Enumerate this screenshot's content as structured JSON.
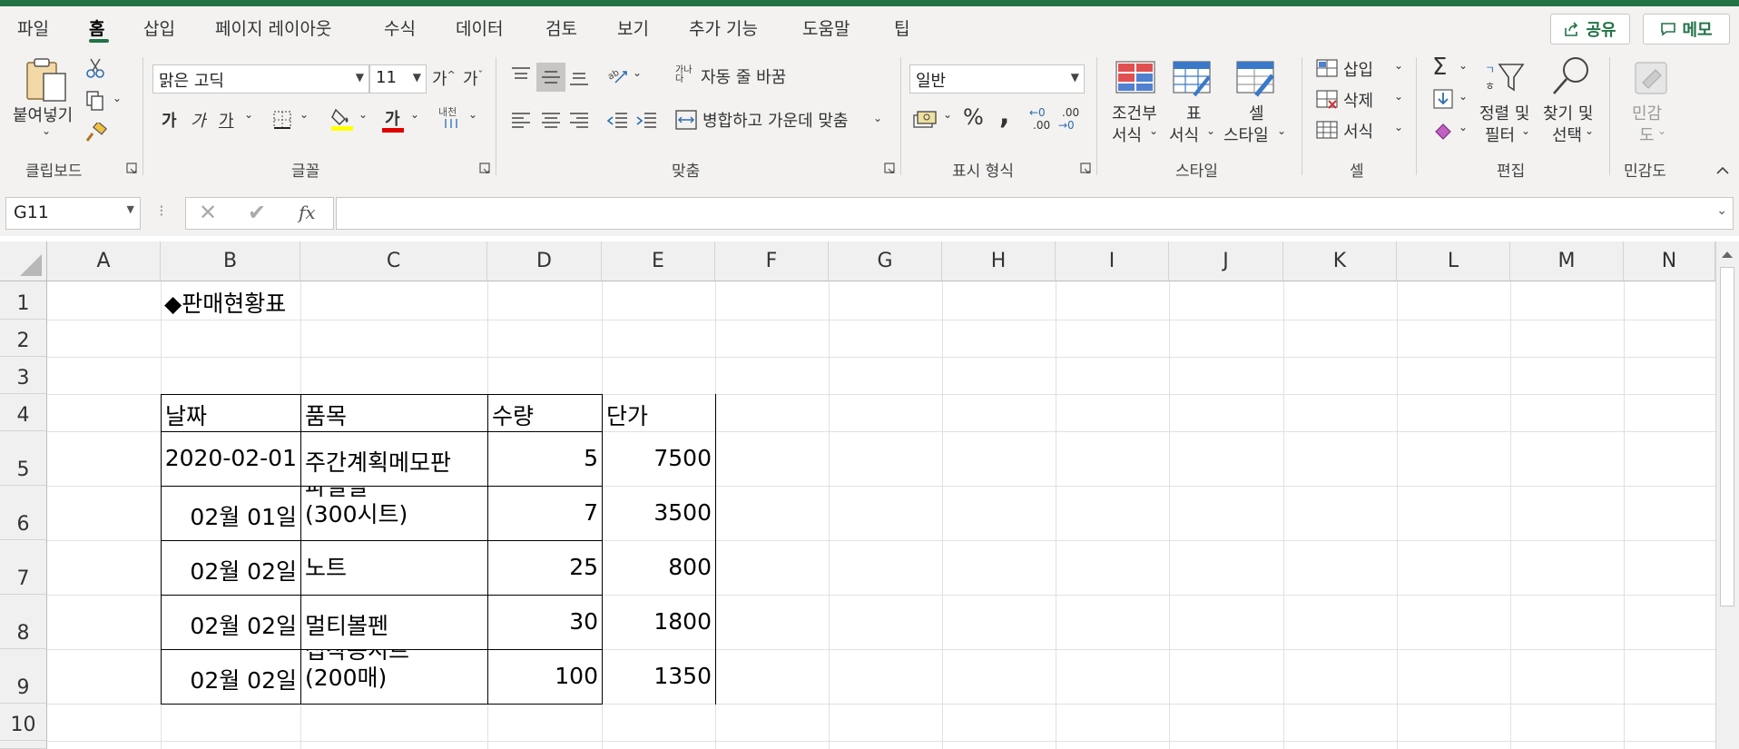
{
  "tabs": [
    "파일",
    "홈",
    "삽입",
    "페이지 레이아웃",
    "수식",
    "데이터",
    "검토",
    "보기",
    "추가 기능",
    "도움말",
    "팁"
  ],
  "active_tab": "홈",
  "share_label": "공유",
  "memo_label": "메모",
  "clipboard": {
    "paste_label": "붙여넣기",
    "group_label": "클립보드"
  },
  "font": {
    "name": "맑은 고딕",
    "size": "11",
    "bold": "가",
    "italic": "가",
    "underline": "가",
    "color_glyph": "가",
    "phonetic_top": "내천",
    "grow": "가",
    "shrink": "가",
    "group_label": "글꼴"
  },
  "alignment": {
    "wrap_text": "자동 줄 바꿈",
    "merge_center": "병합하고 가운데 맞춤",
    "wrap_icon_text": "가나다",
    "group_label": "맞춤"
  },
  "number": {
    "format": "일반",
    "percent": "%",
    "comma": ",",
    "inc_top": "←0",
    "inc_bottom": ".00",
    "dec_top": ".00",
    "dec_bottom": "→0",
    "group_label": "표시 형식"
  },
  "styles": {
    "conditional_l1": "조건부",
    "conditional_l2": "서식",
    "table_l1": "표",
    "table_l2": "서식",
    "cell_l1": "셀",
    "cell_l2": "스타일",
    "group_label": "스타일"
  },
  "cells": {
    "insert": "삽입",
    "delete": "삭제",
    "format": "서식",
    "group_label": "셀"
  },
  "editing": {
    "sort_l1": "정렬 및",
    "sort_l2": "필터",
    "find_l1": "찾기 및",
    "find_l2": "선택",
    "sum_glyph": "Σ",
    "group_label": "편집"
  },
  "sensitivity": {
    "l1": "민감",
    "l2": "도",
    "group_label": "민감도"
  },
  "name_box": "G11",
  "fx_label": "fx",
  "columns": [
    "A",
    "B",
    "C",
    "D",
    "E",
    "F",
    "G",
    "H",
    "I",
    "J",
    "K",
    "L",
    "M",
    "N"
  ],
  "rows": [
    "1",
    "2",
    "3",
    "4",
    "5",
    "6",
    "7",
    "8",
    "9",
    "10"
  ],
  "sheet": {
    "title": "◆판매현황표",
    "headers": [
      "날짜",
      "품목",
      "수량",
      "단가"
    ],
    "data": [
      {
        "date": "2020-02-01",
        "item_l1": "주간계획메모판",
        "item_l2": "",
        "qty": "5",
        "price": "7500"
      },
      {
        "date": "02월 01일",
        "item_l1": "파일철",
        "item_l2": "(300시트)",
        "qty": "7",
        "price": "3500"
      },
      {
        "date": "02월 02일",
        "item_l1": "노트",
        "item_l2": "",
        "qty": "25",
        "price": "800"
      },
      {
        "date": "02월 02일",
        "item_l1": "멀티볼펜",
        "item_l2": "",
        "qty": "30",
        "price": "1800"
      },
      {
        "date": "02월 02일",
        "item_l1": "접착용시트",
        "item_l2": "(200매)",
        "qty": "100",
        "price": "1350"
      }
    ]
  },
  "colors": {
    "excel_green": "#217346",
    "ribbon_bg": "#f3f2f1",
    "font_red": "#e00000",
    "highlight_yellow": "#ffff00"
  }
}
